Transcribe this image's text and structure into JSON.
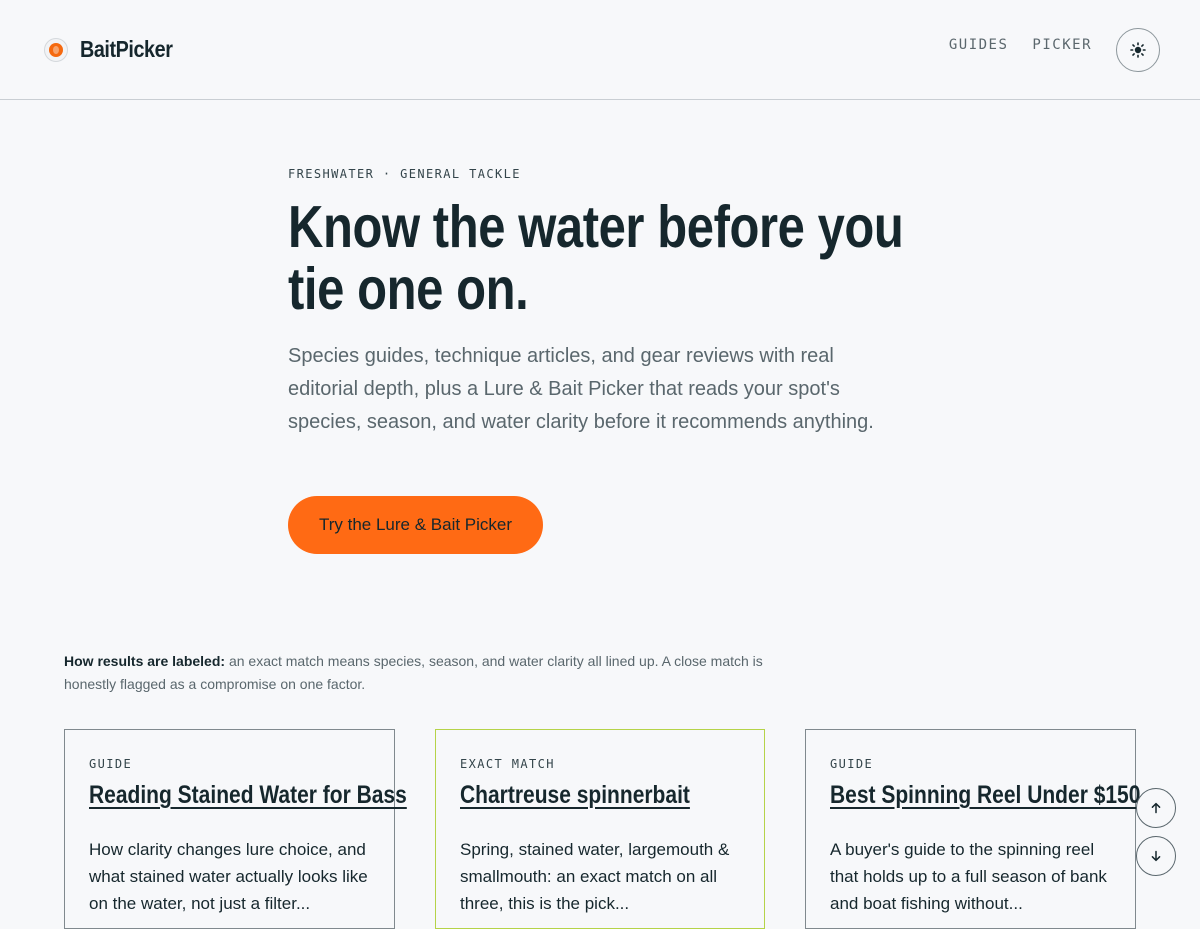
{
  "brand": {
    "name": "BaitPicker",
    "accent": "#ff6a14",
    "icon": "bait-logo-icon"
  },
  "nav": {
    "items": [
      {
        "label": "GUIDES"
      },
      {
        "label": "PICKER"
      }
    ],
    "theme_icon": "sun-icon"
  },
  "hero": {
    "eyebrow": "FRESHWATER · GENERAL TACKLE",
    "title": "Know the water before you tie one on.",
    "subtitle": "Species guides, technique articles, and gear reviews with real editorial depth, plus a Lure & Bait Picker that reads your spot's species, season, and water clarity before it recommends anything.",
    "cta_label": "Try the Lure & Bait Picker"
  },
  "note": {
    "label": "How results are labeled:",
    "text": " an exact match means species, season, and water clarity all lined up. A close match is honestly flagged as a compromise on one factor."
  },
  "cards": [
    {
      "tag": "GUIDE",
      "title": "Reading Stained Water for Bass",
      "desc": "How clarity changes lure choice, and what stained water actually looks like on the water, not just a filter..."
    },
    {
      "tag": "EXACT MATCH",
      "title": "Chartreuse spinnerbait",
      "desc": "Spring, stained water, largemouth & smallmouth: an exact match on all three, this is the pick..."
    },
    {
      "tag": "GUIDE",
      "title": "Best Spinning Reel Under $150",
      "desc": "A buyer's guide to the spinning reel that holds up to a full season of bank and boat fishing without..."
    }
  ],
  "scroll": {
    "up_icon": "arrow-up-icon",
    "down_icon": "arrow-down-icon"
  }
}
